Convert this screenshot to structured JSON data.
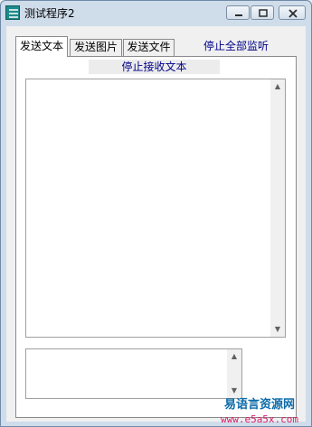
{
  "window": {
    "title": "测试程序2"
  },
  "titlebar": {
    "icons": [
      "app-icon",
      "minimize-icon",
      "maximize-icon",
      "close-icon"
    ]
  },
  "tabs": [
    {
      "label": "发送文本",
      "active": true
    },
    {
      "label": "发送图片",
      "active": false
    },
    {
      "label": "发送文件",
      "active": false
    }
  ],
  "links": {
    "stop_all": "停止全部监听",
    "stop_receive": "停止接收文本"
  },
  "inputs": {
    "receive_value": "",
    "send_value": ""
  },
  "watermark": {
    "brand": "易语言资源网",
    "url": "www.e5a5x.com"
  },
  "colors": {
    "link": "#00008b",
    "watermark_brand": "#0b6aa8",
    "watermark_url": "#d81b6a"
  }
}
